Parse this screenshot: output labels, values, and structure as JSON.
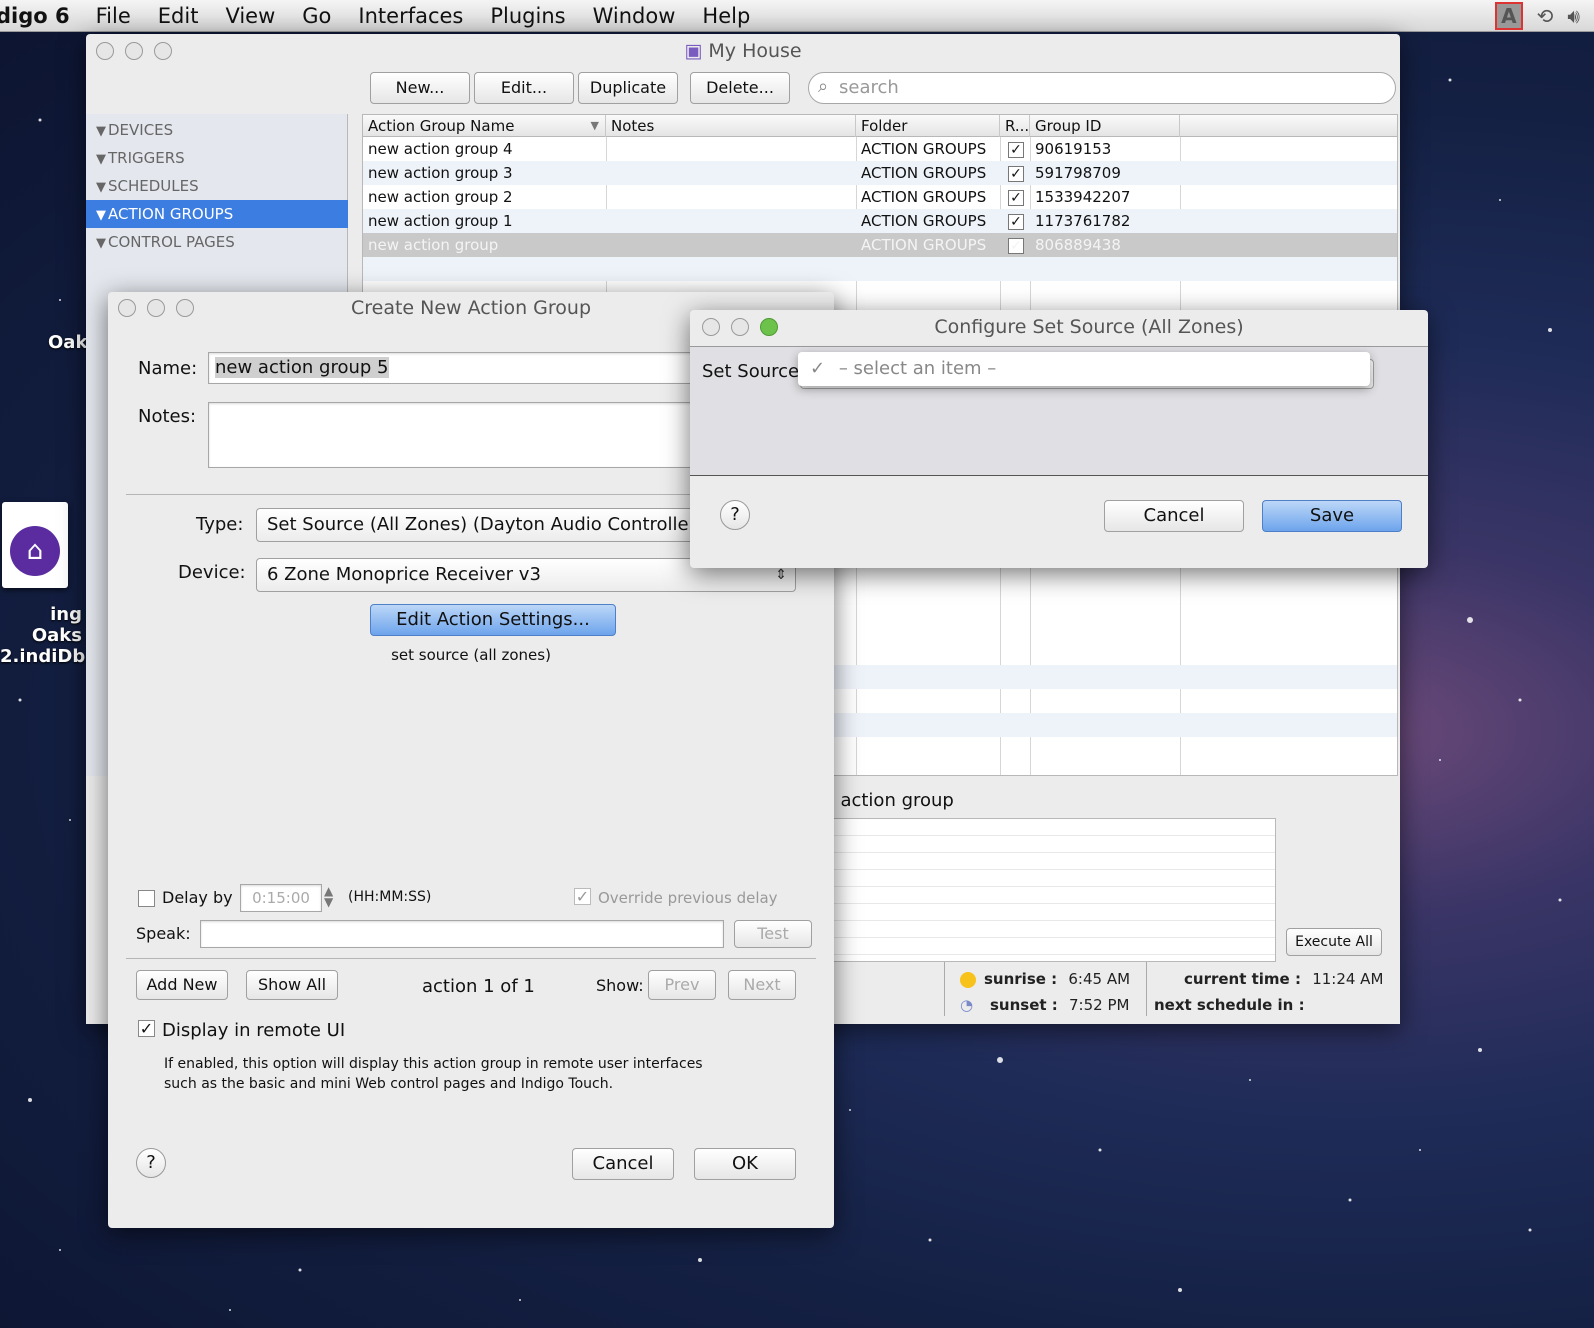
{
  "menubar": {
    "app_name": "digo 6",
    "items": [
      "File",
      "Edit",
      "View",
      "Go",
      "Interfaces",
      "Plugins",
      "Window",
      "Help"
    ],
    "kbd_icon": "A"
  },
  "desktop": {
    "label_top": "Oak",
    "file_label_line1": "ing Oaks",
    "file_label_line2": "2.indiDb"
  },
  "main_window": {
    "title": "My House",
    "toolbar": {
      "new": "New...",
      "edit": "Edit...",
      "duplicate": "Duplicate",
      "delete": "Delete..."
    },
    "search_placeholder": "search",
    "sidebar": [
      "DEVICES",
      "TRIGGERS",
      "SCHEDULES",
      "ACTION GROUPS",
      "CONTROL PAGES"
    ],
    "columns": {
      "name": "Action Group Name",
      "notes": "Notes",
      "folder": "Folder",
      "r": "R...",
      "id": "Group ID"
    },
    "rows": [
      {
        "name": "new action group 4",
        "folder": "ACTION GROUPS",
        "check": "✓",
        "id": "90619153"
      },
      {
        "name": "new action group 3",
        "folder": "ACTION GROUPS",
        "check": "✓",
        "id": "591798709"
      },
      {
        "name": "new action group 2",
        "folder": "ACTION GROUPS",
        "check": "✓",
        "id": "1533942207"
      },
      {
        "name": "new action group 1",
        "folder": "ACTION GROUPS",
        "check": "✓",
        "id": "1173761782"
      },
      {
        "name": "new action group",
        "folder": "ACTION GROUPS",
        "check": "✓",
        "id": "806889438"
      }
    ],
    "detail_title": "w action group",
    "execute_all": "Execute All",
    "sunrise_label": "sunrise :",
    "sunrise_time": "6:45 AM",
    "sunset_label": "sunset :",
    "sunset_time": "7:52 PM",
    "current_time_label": "current time :",
    "current_time": "11:24 AM",
    "next_schedule_label": "next schedule in :"
  },
  "create_dialog": {
    "title": "Create New Action Group",
    "name_label": "Name:",
    "name_value": "new action group 5",
    "notes_label": "Notes:",
    "type_label": "Type:",
    "type_value": "Set Source (All Zones) (Dayton Audio Controller)",
    "device_label": "Device:",
    "device_value": "6 Zone Monoprice Receiver v3",
    "edit_settings": "Edit Action Settings...",
    "summary": "set source (all zones)",
    "delay_label": "Delay by",
    "delay_value": "0:15:00",
    "delay_format": "(HH:MM:SS)",
    "override_label": "Override previous delay",
    "speak_label": "Speak:",
    "test": "Test",
    "add_new": "Add New",
    "show_all": "Show All",
    "action_counter": "action 1 of 1",
    "show_label": "Show:",
    "prev": "Prev",
    "next": "Next",
    "display_remote_label": "Display in remote UI",
    "display_remote_desc_1": "If enabled, this option will display this action group in remote user interfaces",
    "display_remote_desc_2": "such as the basic and mini Web control pages and Indigo Touch.",
    "help": "?",
    "cancel": "Cancel",
    "ok": "OK"
  },
  "config_dialog": {
    "title": "Configure Set Source (All Zones)",
    "set_source_label": "Set Source",
    "dropdown_check": "✓",
    "dropdown_value": "– select an item –",
    "help": "?",
    "cancel": "Cancel",
    "save": "Save"
  },
  "colors": {
    "selection_blue": "#3b7de0",
    "save_button": "#6da4ec"
  }
}
